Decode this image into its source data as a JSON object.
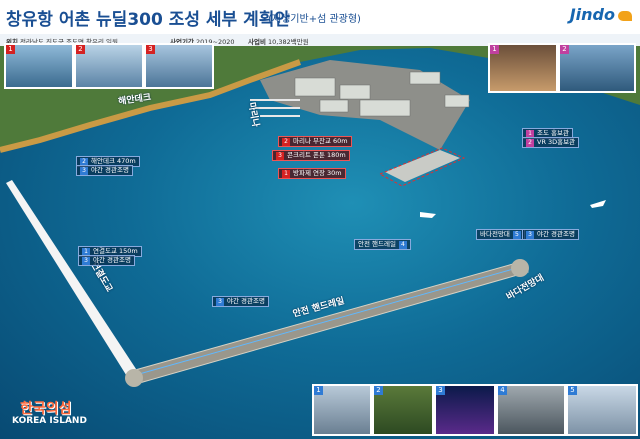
{
  "header": {
    "title": "창유항 어촌 뉴딜300 조성 세부 계획안",
    "subtitle": "(재생기반+섬 관광형)",
    "logo_text": "Jindo"
  },
  "info": {
    "location_label": "위치",
    "location_value": "전라남도 진도군 조도면 창유리 일원",
    "period_label": "사업기간",
    "period_value": "2019~2020",
    "budget_label": "사업비",
    "budget_value": "10,382백만원"
  },
  "labels": {
    "coast_deck": "해안데크",
    "marina": "마리나",
    "breakwater": "연결도교",
    "safety_rail": "안전 핸드레일",
    "sea_view": "바다전망대",
    "safety_rail_top": "안전 핸드레일",
    "sea_view_top": "바다전망대"
  },
  "annotations": {
    "marina_pier": {
      "num": "2",
      "text": "마리나 부잔교 60m"
    },
    "concrete_pontoon": {
      "num": "3",
      "text": "콘크리트 폰툰 180m"
    },
    "breakwater_ext": {
      "num": "1",
      "text": "방파제 연장 30m"
    },
    "deck_len": {
      "num": "2",
      "text": "해안데크 470m"
    },
    "night_light_1": {
      "num": "3",
      "text": "야간 경관조명"
    },
    "bridge_len": {
      "num": "1",
      "text": "연결도교 150m"
    },
    "night_light_2": {
      "num": "3",
      "text": "야간 경관조명"
    },
    "night_light_3": {
      "num": "3",
      "text": "야간 경관조명"
    },
    "promo_hall": {
      "num": "1",
      "text": "조도 홍보관"
    },
    "vr_hall": {
      "num": "2",
      "text": "VR 3D홍보관"
    },
    "rail_tag": {
      "num": "4",
      "text": "안전 핸드레일"
    },
    "view_tag": {
      "num": "5",
      "text": "바다전망대"
    },
    "night_light_4": {
      "num": "3",
      "text": "야간 경관조명"
    }
  },
  "photos_top": [
    "1",
    "2",
    "3"
  ],
  "photos_bottom": [
    "1",
    "2",
    "3",
    "4",
    "5"
  ],
  "brand": {
    "korean": "한국의섬",
    "english": "KOREA ISLAND"
  }
}
